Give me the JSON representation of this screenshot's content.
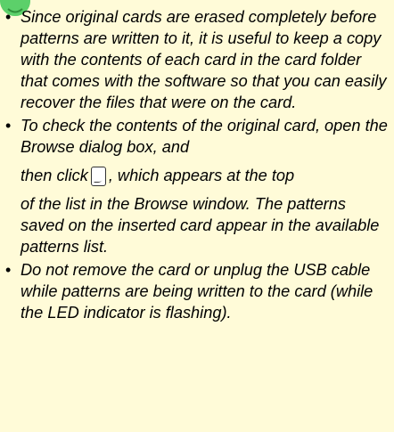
{
  "notes": [
    {
      "text": "Since original cards are erased completely before patterns are written to it, it is useful to keep a copy with the contents of each card in the card folder that comes with the software so that you can easily recover the files that were on the card."
    },
    {
      "line1": "To check the contents of the original card, open the Browse dialog box, and",
      "line2_before": "then click",
      "line2_after": ", which appears at the top",
      "line3": "of the list in the Browse window. The patterns saved on the inserted card appear in the available patterns list.",
      "button_icon": "memory-card-icon"
    },
    {
      "text": "Do not remove the card or unplug the USB cable while patterns are being written to the card (while the LED indicator is flashing)."
    }
  ],
  "colors": {
    "background": "#fffbd8",
    "note_icon": "#5cd06a",
    "text": "#000000"
  },
  "icons": {
    "header": "note-icon",
    "bullet": "bullet-icon"
  }
}
